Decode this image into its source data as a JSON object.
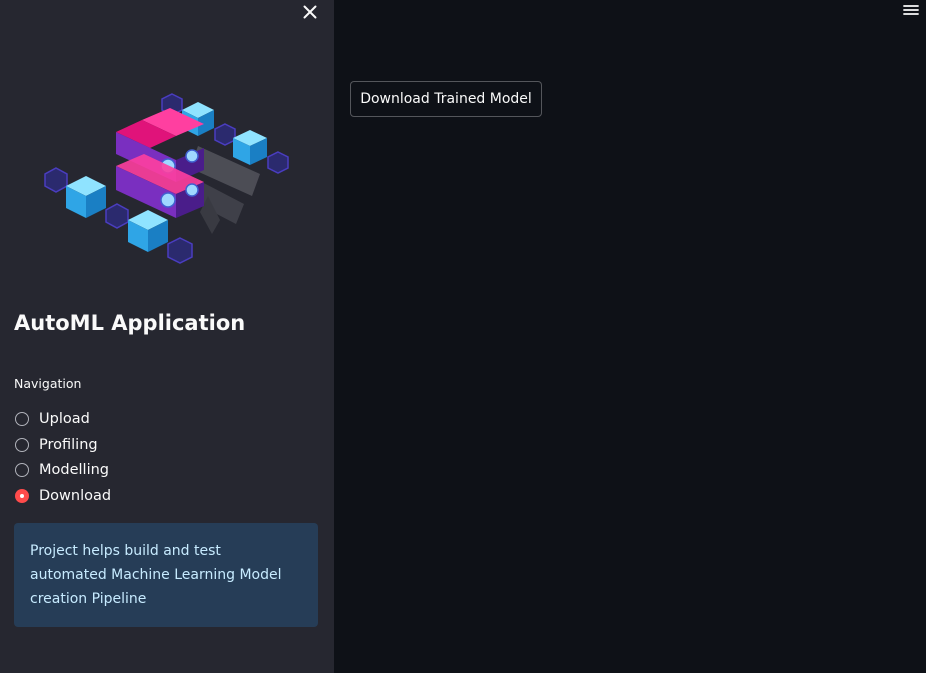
{
  "sidebar": {
    "close_icon": "close-icon",
    "hero_image": "isometric-server-cubes-illustration",
    "title": "AutoML Application",
    "navigation": {
      "label": "Navigation",
      "options": [
        "Upload",
        "Profiling",
        "Modelling",
        "Download"
      ],
      "selected": "Download"
    },
    "info": {
      "text": "Project helps build and test automated Machine Learning Model creation Pipeline"
    }
  },
  "main": {
    "menu_icon": "hamburger-menu-icon",
    "download_button_label": "Download Trained Model"
  },
  "colors": {
    "sidebar_bg": "#262730",
    "main_bg": "#0e1117",
    "accent": "#ff4b4b",
    "info_bg": "#263d57",
    "info_text": "#c7ebff"
  }
}
